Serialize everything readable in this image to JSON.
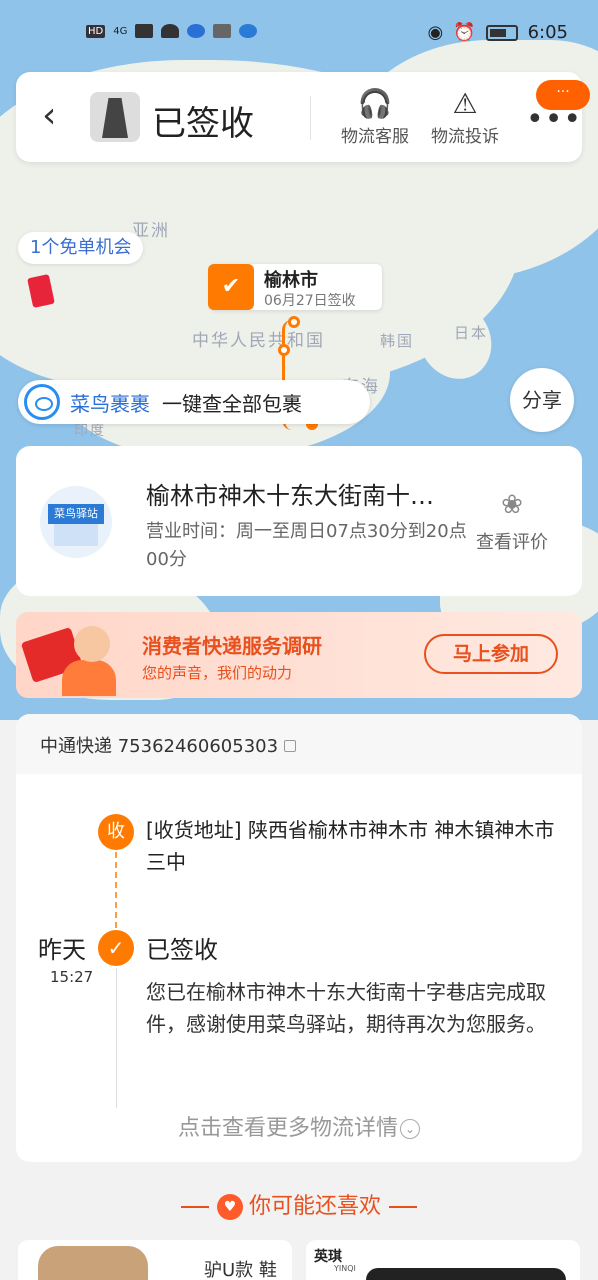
{
  "status_bar": {
    "left_icons": [
      "HD",
      "4G",
      "signal-icon",
      "wifi-icon",
      "app-icon",
      "app-icon",
      "app-icon"
    ],
    "time": "6:05"
  },
  "header": {
    "title": "已签收",
    "service_label": "物流客服",
    "complaint_label": "物流投诉",
    "badge": "···"
  },
  "map": {
    "labels": [
      "亚洲",
      "中华人民共和国",
      "韩国",
      "日本",
      "东海",
      "印度"
    ],
    "free_chance": "1个免单机会",
    "pin_city": "榆林市",
    "pin_date": "06月27日签收",
    "cainiao_brand": "菜鸟裹裹",
    "cainiao_text": "一键查全部包裹",
    "share_label": "分享"
  },
  "station": {
    "logo_text": "菜鸟驿站",
    "name": "榆林市神木十东大街南十…",
    "hours": "营业时间：周一至周日07点30分到20点00分",
    "review_label": "查看评价"
  },
  "survey": {
    "title": "消费者快递服务调研",
    "subtitle": "您的声音，我们的动力",
    "button": "马上参加"
  },
  "tracking": {
    "carrier": "中通快递 75362460605303",
    "node1_badge": "收",
    "address": "[收货地址] 陕西省榆林市神木市 神木镇神木市三中",
    "day": "昨天",
    "time": "15:27",
    "status_title": "已签收",
    "status_desc": "您已在榆林市神木十东大街南十字巷店完成取件，感谢使用菜鸟驿站，期待再次为您服务。",
    "more": "点击查看更多物流详情"
  },
  "recommend": {
    "title": "你可能还喜欢",
    "product1_text": "驴U款 鞋鱼",
    "product2_brand": "英琪",
    "product2_sub": "YINQI"
  }
}
